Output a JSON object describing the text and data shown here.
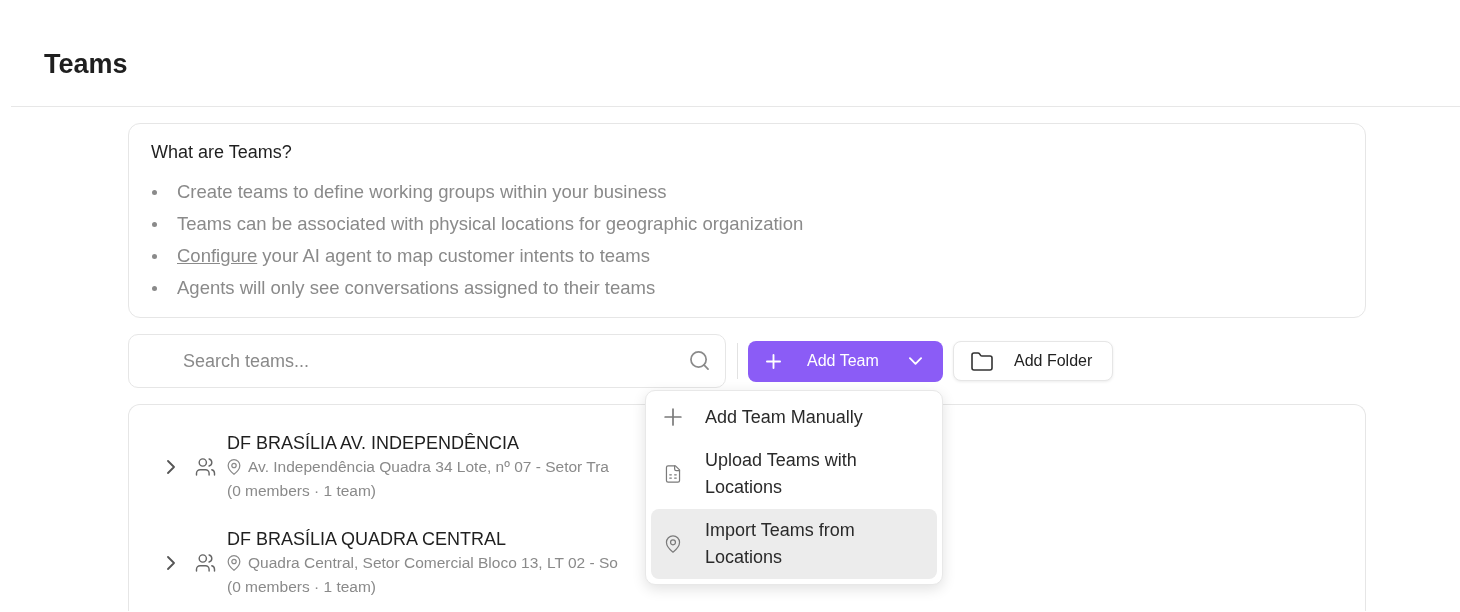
{
  "page": {
    "title": "Teams"
  },
  "info": {
    "title": "What are Teams?",
    "bullets": [
      {
        "text": "Create teams to define working groups within your business"
      },
      {
        "text": "Teams can be associated with physical locations for geographic organization"
      },
      {
        "link": "Configure",
        "text": "your AI agent to map customer intents to teams"
      },
      {
        "text": "Agents will only see conversations assigned to their teams"
      }
    ]
  },
  "toolbar": {
    "search": {
      "placeholder": "Search teams..."
    },
    "add_team": {
      "label": "Add Team",
      "menu": {
        "open": true,
        "items": [
          {
            "kind": "manual",
            "label": "Add Team Manually",
            "highlighted": false
          },
          {
            "kind": "upload",
            "label": "Upload Teams with Locations",
            "highlighted": false
          },
          {
            "kind": "import",
            "label": "Import Teams from Locations",
            "highlighted": true
          }
        ]
      }
    },
    "add_folder": {
      "label": "Add Folder"
    }
  },
  "teams": [
    {
      "name": "DF BRASÍLIA AV. INDEPENDÊNCIA",
      "address": "Av. Independência Quadra 34 Lote, nº 07 - Setor Tra",
      "summary": "(0 members · 1 team)",
      "expanded": false
    },
    {
      "name": "DF BRASÍLIA QUADRA CENTRAL",
      "address": "Quadra Central, Setor Comercial Bloco 13, LT 02 - So",
      "summary": "(0 members · 1 team)",
      "expanded": false
    }
  ]
}
